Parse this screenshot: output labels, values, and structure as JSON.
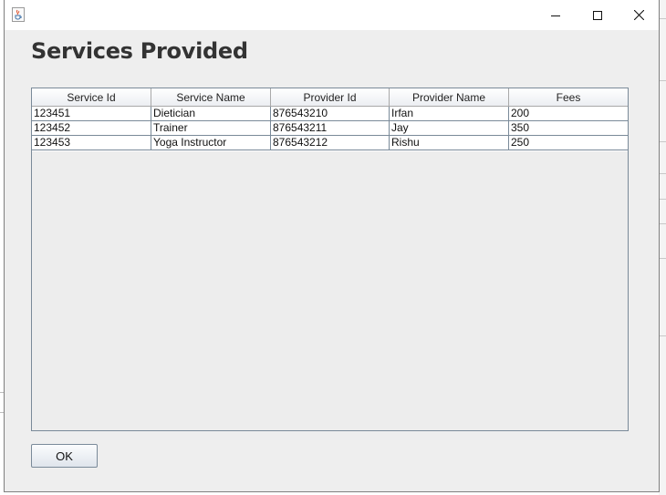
{
  "window": {
    "title": "",
    "controls": {
      "minimize": "minimize-icon",
      "maximize": "maximize-icon",
      "close": "close-icon"
    },
    "app_icon": "java-cup-icon"
  },
  "page_title": "Services Provided",
  "table": {
    "columns": [
      "Service Id",
      "Service Name",
      "Provider Id",
      "Provider Name",
      "Fees"
    ],
    "rows": [
      [
        "123451",
        "Dietician",
        "876543210",
        "Irfan",
        "200"
      ],
      [
        "123452",
        "Trainer",
        "876543211",
        "Jay",
        "350"
      ],
      [
        "123453",
        "Yoga Instructor",
        "876543212",
        "Rishu",
        "250"
      ]
    ]
  },
  "buttons": {
    "ok_label": "OK"
  },
  "colors": {
    "window_bg": "#eeeeee",
    "border": "#7a8a99",
    "title_text": "#333333"
  }
}
